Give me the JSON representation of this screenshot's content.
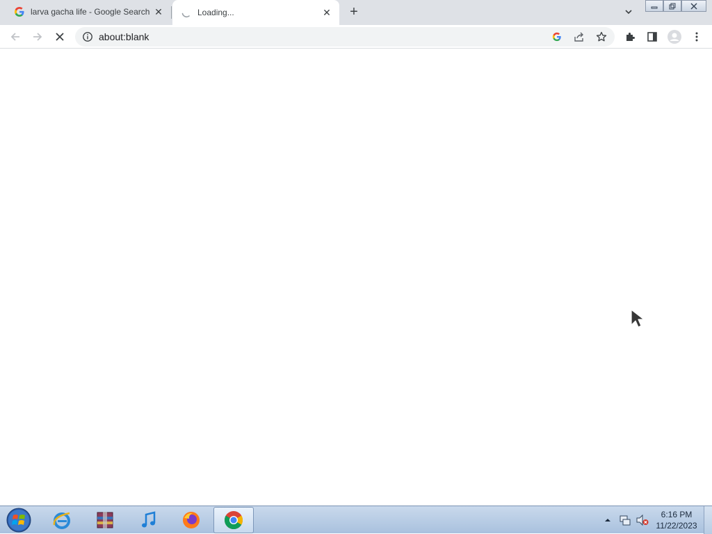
{
  "browser": {
    "tabs": [
      {
        "title": "larva gacha life - Google Search",
        "active": false,
        "favicon": "google-g-icon"
      },
      {
        "title": "Loading...",
        "active": true,
        "favicon": "loading-spinner-icon"
      }
    ],
    "new_tab_symbol": "+",
    "close_symbol": "✕",
    "window_controls": {
      "minimize": "▭",
      "restore": "❐",
      "close": "✕"
    },
    "toolbar": {
      "back_icon": "back-arrow-icon",
      "forward_icon": "forward-arrow-icon",
      "stop_icon": "stop-icon",
      "url": "about:blank",
      "omnibox_icons": [
        "google-lens-icon",
        "share-icon",
        "bookmark-star-icon"
      ],
      "right_icons": [
        "extensions-icon",
        "side-panel-icon",
        "profile-avatar-icon",
        "menu-icon"
      ]
    }
  },
  "page": {
    "content": ""
  },
  "taskbar": {
    "start_icon": "windows-start-orb-icon",
    "pinned": [
      "internet-explorer-icon",
      "winrar-icon",
      "itunes-icon",
      "firefox-icon",
      "chrome-icon"
    ],
    "active_app": "chrome-icon",
    "tray_icons": [
      "show-hidden-icons-icon",
      "network-icon",
      "volume-muted-icon"
    ],
    "time": "6:16 PM",
    "date": "11/22/2023"
  },
  "colors": {
    "tabstrip": "#dee1e6",
    "omnibox": "#f1f3f4",
    "taskbar": "#b9cde5"
  }
}
